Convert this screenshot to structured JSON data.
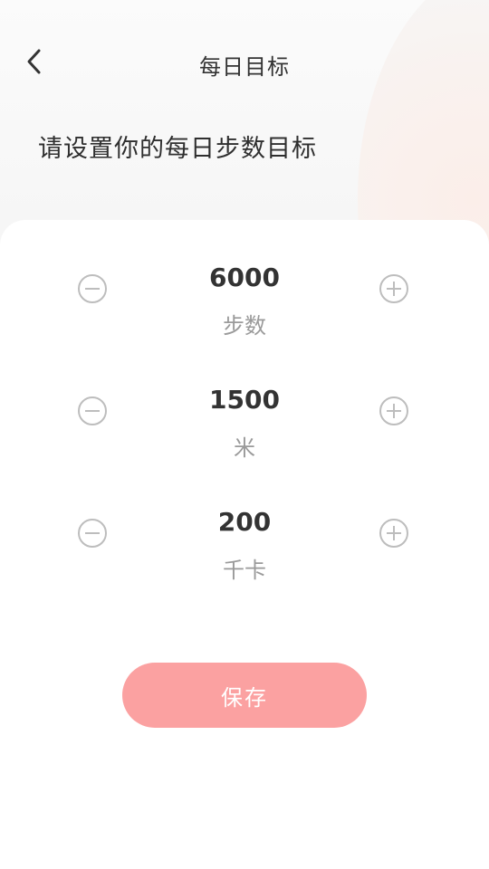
{
  "header": {
    "title": "每日目标",
    "back_icon": "chevron-left-icon"
  },
  "subtitle": "请设置你的每日步数目标",
  "goals": [
    {
      "value": "6000",
      "unit": "步数",
      "minus_icon": "minus-circle-icon",
      "plus_icon": "plus-circle-icon"
    },
    {
      "value": "1500",
      "unit": "米",
      "minus_icon": "minus-circle-icon",
      "plus_icon": "plus-circle-icon"
    },
    {
      "value": "200",
      "unit": "千卡",
      "minus_icon": "minus-circle-icon",
      "plus_icon": "plus-circle-icon"
    }
  ],
  "save_button": {
    "label": "保存"
  },
  "colors": {
    "accent": "#fba1a1",
    "text_primary": "#333333",
    "text_secondary": "#9a9a9a",
    "icon_stroke": "#bdbdbd"
  }
}
